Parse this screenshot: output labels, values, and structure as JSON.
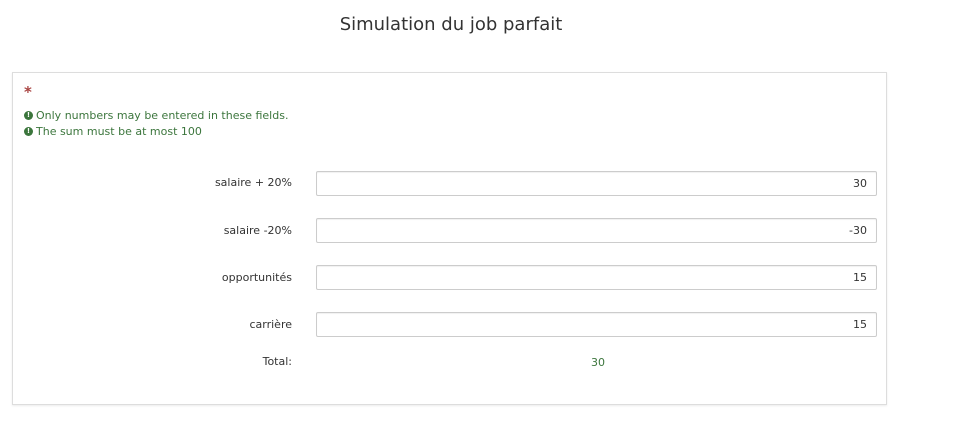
{
  "page": {
    "title": "Simulation du job parfait"
  },
  "form": {
    "mandatory_marker": "*",
    "tips": [
      {
        "icon": "exclamation-circle-icon",
        "text": "Only numbers may be entered in these fields."
      },
      {
        "icon": "exclamation-circle-icon",
        "text": "The sum must be at most 100"
      }
    ],
    "fields": [
      {
        "label": "salaire + 20%",
        "value": "30"
      },
      {
        "label": "salaire -20%",
        "value": "-30"
      },
      {
        "label": "opportunités",
        "value": "15"
      },
      {
        "label": "carrière",
        "value": "15"
      }
    ],
    "total": {
      "label": "Total:",
      "value": "30"
    }
  },
  "colors": {
    "tip_green": "#3c763d",
    "asterisk_red": "#a94442",
    "total_green": "#3c763d"
  }
}
